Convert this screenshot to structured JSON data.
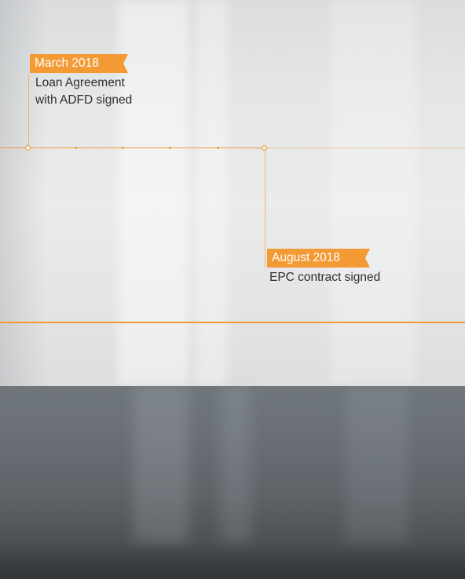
{
  "timeline": {
    "events": [
      {
        "date": "March 2018",
        "description_lines": [
          "Loan Agreement",
          "with ADFD signed"
        ]
      },
      {
        "date": "August 2018",
        "description_lines": [
          "EPC contract signed"
        ]
      }
    ]
  },
  "colors": {
    "accent": "#f39a34",
    "text": "#2d2f31",
    "tag_text": "#ffffff",
    "background_top": "#e4e6e7",
    "background_bottom": "#4d5155"
  }
}
